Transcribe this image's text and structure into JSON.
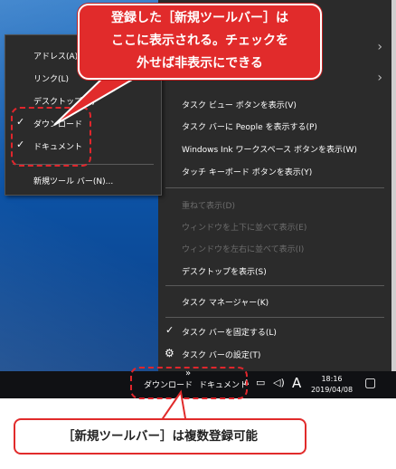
{
  "context_menu": {
    "items": [
      {
        "label": "",
        "arrow": true
      },
      {
        "label": "",
        "arrow": true
      },
      {
        "label": "タスク ビュー ボタンを表示(V)"
      },
      {
        "label": "タスク バーに People を表示する(P)"
      },
      {
        "label": "Windows Ink ワークスペース ボタンを表示(W)"
      },
      {
        "label": "タッチ キーボード ボタンを表示(Y)"
      },
      {
        "label": "重ねて表示(D)",
        "disabled": true
      },
      {
        "label": "ウィンドウを上下に並べて表示(E)",
        "disabled": true
      },
      {
        "label": "ウィンドウを左右に並べて表示(I)",
        "disabled": true
      },
      {
        "label": "デスクトップを表示(S)"
      },
      {
        "label": "タスク マネージャー(K)"
      },
      {
        "label": "タスク バーを固定する(L)",
        "checked": true
      },
      {
        "label": "タスク バーの設定(T)",
        "icon": "gear-icon"
      }
    ]
  },
  "toolbar_submenu": {
    "items": [
      {
        "label": "アドレス(A)",
        "checked": false
      },
      {
        "label": "リンク(L)",
        "checked": false
      },
      {
        "label": "デスクトップ(D)",
        "checked": false
      },
      {
        "label": "ダウンロード",
        "checked": true
      },
      {
        "label": "ドキュメント",
        "checked": true
      },
      {
        "label": "新規ツール バー(N)...",
        "checked": false
      }
    ]
  },
  "taskbar": {
    "toolbars": [
      {
        "label": "ダウンロード"
      },
      {
        "label": "ドキュメント"
      }
    ],
    "overflow_glyph": "»",
    "tray_up_glyph": "∧",
    "ime_glyph": "A",
    "clock_time": "18:16",
    "clock_date": "2019/04/08"
  },
  "annotations": {
    "top_callout_lines": [
      "登録した［新規ツールバー］は",
      "ここに表示される。チェックを",
      "外せば非表示にできる"
    ],
    "bottom_callout": "［新規ツールバー］は複数登録可能"
  },
  "colors": {
    "menu_bg": "#2b2b2b",
    "callout_red": "#e12b2b",
    "desktop_blue": "#0d55a9"
  }
}
